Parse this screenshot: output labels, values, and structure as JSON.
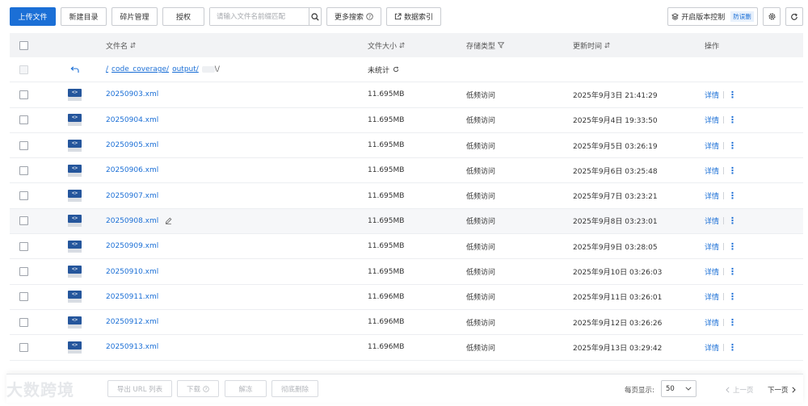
{
  "toolbar": {
    "upload_label": "上传文件",
    "new_dir_label": "新建目录",
    "fragments_label": "碎片管理",
    "authorize_label": "授权",
    "search_placeholder": "请输入文件名前缀匹配",
    "more_search_label": "更多搜索",
    "data_index_label": "数据索引",
    "versioning_label": "开启版本控制",
    "versioning_badge": "防误删"
  },
  "table": {
    "headers": {
      "name": "文件名",
      "size": "文件大小",
      "storage": "存储类型",
      "updated": "更新时间",
      "actions": "操作"
    },
    "parent_row": {
      "path_root": "/",
      "path_seg1": "code_coverage/",
      "path_seg2": "output/",
      "path_tail": "\\/",
      "size_text": "未统计"
    },
    "rows": [
      {
        "name": "20250903.xml",
        "size": "11.695MB",
        "storage": "低频访问",
        "updated": "2025年9月3日 21:41:29",
        "detail": "详情"
      },
      {
        "name": "20250904.xml",
        "size": "11.695MB",
        "storage": "低频访问",
        "updated": "2025年9月4日 19:33:50",
        "detail": "详情"
      },
      {
        "name": "20250905.xml",
        "size": "11.695MB",
        "storage": "低频访问",
        "updated": "2025年9月5日 03:26:19",
        "detail": "详情"
      },
      {
        "name": "20250906.xml",
        "size": "11.695MB",
        "storage": "低频访问",
        "updated": "2025年9月6日 03:25:48",
        "detail": "详情"
      },
      {
        "name": "20250907.xml",
        "size": "11.695MB",
        "storage": "低频访问",
        "updated": "2025年9月7日 03:23:21",
        "detail": "详情"
      },
      {
        "name": "20250908.xml",
        "size": "11.695MB",
        "storage": "低频访问",
        "updated": "2025年9月8日 03:23:01",
        "detail": "详情"
      },
      {
        "name": "20250909.xml",
        "size": "11.695MB",
        "storage": "低频访问",
        "updated": "2025年9月9日 03:28:05",
        "detail": "详情"
      },
      {
        "name": "20250910.xml",
        "size": "11.695MB",
        "storage": "低频访问",
        "updated": "2025年9月10日 03:26:03",
        "detail": "详情"
      },
      {
        "name": "20250911.xml",
        "size": "11.696MB",
        "storage": "低频访问",
        "updated": "2025年9月11日 03:26:01",
        "detail": "详情"
      },
      {
        "name": "20250912.xml",
        "size": "11.696MB",
        "storage": "低频访问",
        "updated": "2025年9月12日 03:26:26",
        "detail": "详情"
      },
      {
        "name": "20250913.xml",
        "size": "11.696MB",
        "storage": "低频访问",
        "updated": "2025年9月13日 03:29:42",
        "detail": "详情"
      }
    ]
  },
  "bottom": {
    "export_label": "导出 URL 列表",
    "download_label": "下载",
    "unfreeze_label": "解冻",
    "delete_label": "彻底删除",
    "page_size_label": "每页显示:",
    "page_size_value": "50",
    "prev_label": "上一页",
    "next_label": "下一页",
    "watermark": "大数跨境"
  }
}
